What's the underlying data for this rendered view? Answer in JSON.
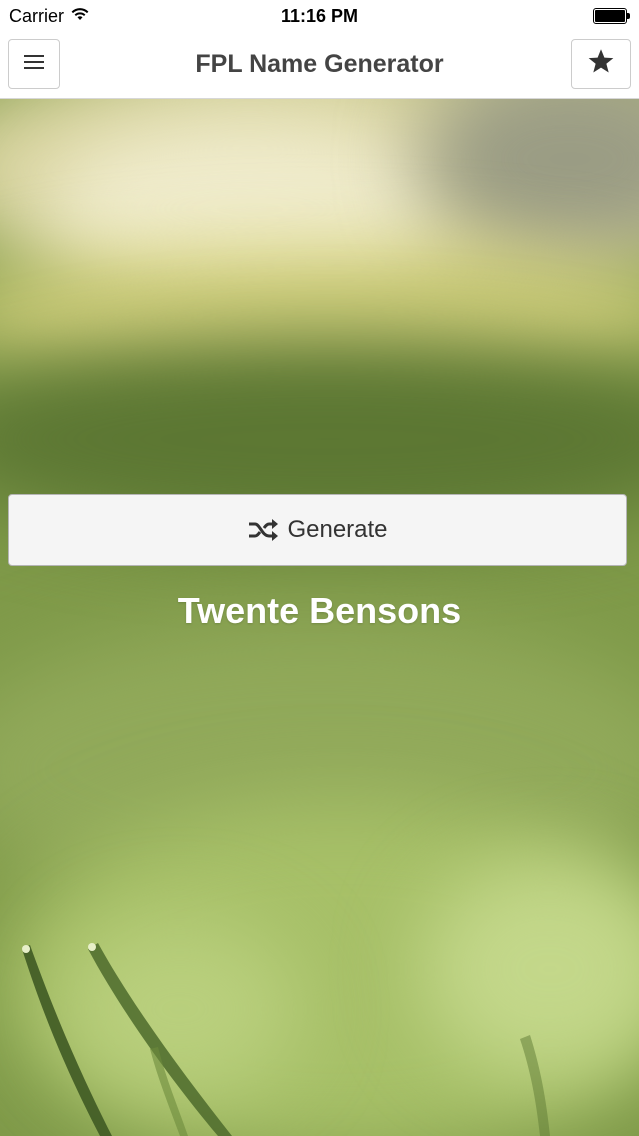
{
  "status_bar": {
    "carrier": "Carrier",
    "time": "11:16 PM"
  },
  "nav_bar": {
    "title": "FPL Name Generator",
    "menu_icon": "hamburger-menu-icon",
    "favorite_icon": "star-icon"
  },
  "main": {
    "generate_label": "Generate",
    "generate_icon": "shuffle-icon",
    "generated_name": "Twente Bensons"
  },
  "colors": {
    "nav_title": "#444444",
    "button_bg": "#f5f5f5",
    "name_text": "#ffffff"
  }
}
